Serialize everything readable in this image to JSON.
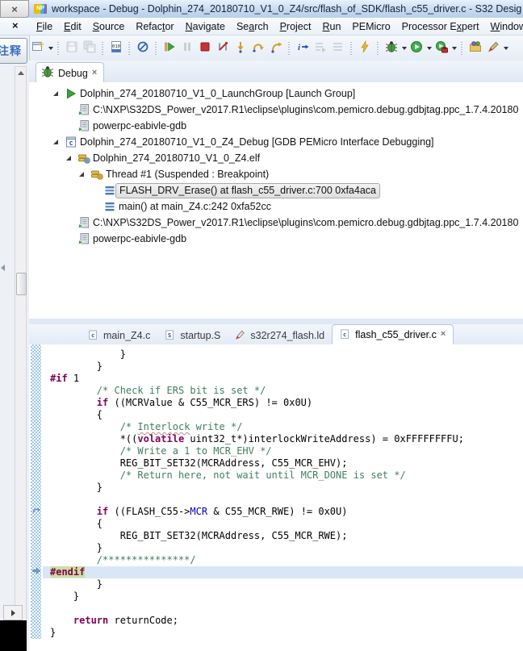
{
  "window": {
    "title": "workspace - Debug - Dolphin_274_20180710_V1_0_Z4/src/flash_of_SDK/flash_c55_driver.c - S32 Desig",
    "app_icon": "nxp-logo",
    "app_icon_text": "NP",
    "background_close_glyph": "×",
    "stray_close_glyph": "×"
  },
  "menu_bar": {
    "items": [
      {
        "label": "File",
        "u": 0
      },
      {
        "label": "Edit",
        "u": 0
      },
      {
        "label": "Source",
        "u": 0
      },
      {
        "label": "Refactor",
        "u": 5
      },
      {
        "label": "Navigate",
        "u": 0
      },
      {
        "label": "Search",
        "u": 2
      },
      {
        "label": "Project",
        "u": 0
      },
      {
        "label": "Run",
        "u": 0
      },
      {
        "label": "PEMicro",
        "u": -1
      },
      {
        "label": "Processor Expert",
        "u": 11
      },
      {
        "label": "Window",
        "u": 0
      }
    ]
  },
  "toolbar": {
    "buttons": [
      {
        "name": "new-wizard-button",
        "icon": "new",
        "dd": true
      },
      {
        "name": "save-button",
        "icon": "save",
        "enabled": false,
        "sep": true
      },
      {
        "name": "save-all-button",
        "icon": "save-all",
        "enabled": false
      },
      {
        "name": "binary-console-button",
        "icon": "binary",
        "label": "010",
        "sep": true
      },
      {
        "name": "skip-all-breakpoints-button",
        "icon": "skip-bp",
        "sep": true
      },
      {
        "name": "resume-button",
        "icon": "resume",
        "sep": true
      },
      {
        "name": "suspend-button",
        "icon": "pause",
        "enabled": false
      },
      {
        "name": "terminate-button",
        "icon": "stop"
      },
      {
        "name": "disconnect-button",
        "icon": "disconnect"
      },
      {
        "name": "step-into-button",
        "icon": "step-into"
      },
      {
        "name": "step-over-button",
        "icon": "step-over"
      },
      {
        "name": "step-return-button",
        "icon": "step-return"
      },
      {
        "name": "instruction-stepping-button",
        "icon": "istep",
        "label": "i",
        "sep": true
      },
      {
        "name": "show-full-paths-button",
        "icon": "paths",
        "enabled": false
      },
      {
        "name": "pin-debug-context-button",
        "icon": "pin",
        "enabled": false
      },
      {
        "name": "flash-programmer-button",
        "icon": "flash",
        "sep": true
      },
      {
        "name": "debug-button",
        "icon": "bug",
        "dd": true,
        "sep": true
      },
      {
        "name": "run-button",
        "icon": "run",
        "dd": true
      },
      {
        "name": "external-tools-button",
        "icon": "ext",
        "dd": true
      },
      {
        "name": "open-wizard-button",
        "icon": "folder",
        "sep": true
      },
      {
        "name": "marker-button",
        "icon": "marker",
        "dd": true
      }
    ]
  },
  "left_rail": {
    "annotation_label": "注释"
  },
  "debug_view": {
    "tab_label": "Debug",
    "close_glyph": "×",
    "tree": [
      {
        "depth": 0,
        "expanded": true,
        "icon": "launch-group",
        "label": "Dolphin_274_20180710_V1_0_LaunchGroup [Launch Group]"
      },
      {
        "depth": 1,
        "icon": "process",
        "label": "C:\\NXP\\S32DS_Power_v2017.R1\\eclipse\\plugins\\com.pemicro.debug.gdbjtag.ppc_1.7.4.20180"
      },
      {
        "depth": 1,
        "icon": "process",
        "label": "powerpc-eabivle-gdb"
      },
      {
        "depth": 0,
        "expanded": true,
        "icon": "c-app",
        "label": "Dolphin_274_20180710_V1_0_Z4_Debug [GDB PEMicro Interface Debugging]"
      },
      {
        "depth": 1,
        "expanded": true,
        "icon": "elf",
        "label": "Dolphin_274_20180710_V1_0_Z4.elf"
      },
      {
        "depth": 2,
        "expanded": true,
        "icon": "thread",
        "label": "Thread #1 (Suspended : Breakpoint)"
      },
      {
        "depth": 3,
        "icon": "stack-frame",
        "label": "FLASH_DRV_Erase() at flash_c55_driver.c:700 0xfa4aca",
        "selected": true
      },
      {
        "depth": 3,
        "icon": "stack-frame",
        "label": "main() at main_Z4.c:242 0xfa52cc"
      },
      {
        "depth": 1,
        "icon": "process",
        "label": "C:\\NXP\\S32DS_Power_v2017.R1\\eclipse\\plugins\\com.pemicro.debug.gdbjtag.ppc_1.7.4.20180"
      },
      {
        "depth": 1,
        "icon": "process",
        "label": "powerpc-eabivle-gdb"
      }
    ]
  },
  "editor": {
    "tabs": [
      {
        "label": "main_Z4.c",
        "icon": "c-file"
      },
      {
        "label": "startup.S",
        "icon": "s-file"
      },
      {
        "label": "s32r274_flash.ld",
        "icon": "ld-file"
      },
      {
        "label": "flash_c55_driver.c",
        "icon": "c-file",
        "active": true,
        "close": true
      }
    ],
    "close_glyph": "×",
    "ruler_markers": [
      {
        "line": 14,
        "type": "caller-arrow"
      },
      {
        "line": 19,
        "type": "instruction-pointer"
      }
    ],
    "code_lines": [
      {
        "tokens": [
          [
            "p",
            "            }"
          ]
        ]
      },
      {
        "tokens": [
          [
            "p",
            "        }"
          ]
        ]
      },
      {
        "tokens": [
          [
            "d",
            "#if"
          ],
          [
            "p",
            " 1"
          ]
        ]
      },
      {
        "tokens": [
          [
            "p",
            "        "
          ],
          [
            "c",
            "/* Check if ERS bit is set */"
          ]
        ]
      },
      {
        "tokens": [
          [
            "p",
            "        "
          ],
          [
            "k",
            "if"
          ],
          [
            "p",
            " ((MCRValue & C55_MCR_ERS) != 0x0U)"
          ]
        ]
      },
      {
        "tokens": [
          [
            "p",
            "        {"
          ]
        ]
      },
      {
        "tokens": [
          [
            "p",
            "            "
          ],
          [
            "c",
            "/* "
          ],
          [
            "csp",
            "Interlock"
          ],
          [
            "c",
            " write */"
          ]
        ]
      },
      {
        "tokens": [
          [
            "p",
            "            *(("
          ],
          [
            "k",
            "volatile"
          ],
          [
            "p",
            " uint32_t*)interlockWriteAddress) = 0xFFFFFFFFU;"
          ]
        ]
      },
      {
        "tokens": [
          [
            "p",
            "            "
          ],
          [
            "c",
            "/* Write a 1 to MCR_EHV */"
          ]
        ]
      },
      {
        "tokens": [
          [
            "p",
            "            REG_BIT_SET32(MCRAddress, C55_MCR_EHV);"
          ]
        ]
      },
      {
        "tokens": [
          [
            "p",
            "            "
          ],
          [
            "c",
            "/* Return here, not wait until MCR_DONE is set */"
          ]
        ]
      },
      {
        "tokens": [
          [
            "p",
            "        }"
          ]
        ]
      },
      {
        "tokens": [
          [
            "p",
            ""
          ]
        ]
      },
      {
        "tokens": [
          [
            "p",
            "        "
          ],
          [
            "k",
            "if"
          ],
          [
            "p",
            " ((FLASH_C55->"
          ],
          [
            "f",
            "MCR"
          ],
          [
            "p",
            " & C55_MCR_RWE) != 0x0U)"
          ]
        ]
      },
      {
        "tokens": [
          [
            "p",
            "        {"
          ]
        ]
      },
      {
        "tokens": [
          [
            "p",
            "            REG_BIT_SET32(MCRAddress, C55_MCR_RWE);"
          ]
        ]
      },
      {
        "tokens": [
          [
            "p",
            "        }"
          ]
        ]
      },
      {
        "tokens": [
          [
            "p",
            "        "
          ],
          [
            "c",
            "/***************/"
          ]
        ]
      },
      {
        "hl": true,
        "tokens": [
          [
            "docc",
            "#endif"
          ]
        ]
      },
      {
        "tokens": [
          [
            "p",
            "        }"
          ]
        ]
      },
      {
        "tokens": [
          [
            "p",
            "    }"
          ]
        ]
      },
      {
        "tokens": [
          [
            "p",
            ""
          ]
        ]
      },
      {
        "tokens": [
          [
            "p",
            "    "
          ],
          [
            "k",
            "return"
          ],
          [
            "p",
            " returnCode;"
          ]
        ]
      },
      {
        "tokens": [
          [
            "p",
            "}"
          ]
        ]
      }
    ]
  }
}
